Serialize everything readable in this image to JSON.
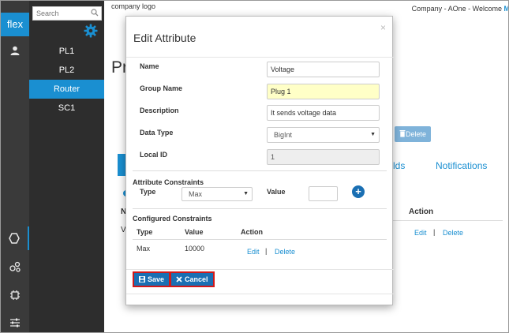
{
  "rail": {
    "logo": "flex",
    "icons": [
      "user-icon",
      "hexagon-icon",
      "network-icon",
      "chip-icon",
      "sliders-icon"
    ]
  },
  "sidebar": {
    "search_placeholder": "Search",
    "items": [
      {
        "label": "PL1",
        "active": false
      },
      {
        "label": "PL2",
        "active": false
      },
      {
        "label": "Router",
        "active": true
      },
      {
        "label": "SC1",
        "active": false
      }
    ]
  },
  "header": {
    "company_logo": "company logo",
    "welcome_text": "Company - AOne - Welcome",
    "user_initial": "M"
  },
  "background": {
    "page_title": "Pr",
    "delete_label": "Delete",
    "tab_fields": "lds",
    "tab_notifications": "Notifications",
    "col_n": "N",
    "col_v": "V",
    "action_header": "Action",
    "edit_label": "Edit",
    "sep": "|",
    "delete_link": "Delete"
  },
  "modal": {
    "title": "Edit Attribute",
    "close": "×",
    "fields": {
      "name_label": "Name",
      "name_value": "Voltage",
      "group_label": "Group Name",
      "group_value": "Plug 1",
      "desc_label": "Description",
      "desc_value": "It sends voltage data",
      "type_label": "Data Type",
      "type_value": "BigInt",
      "id_label": "Local ID",
      "id_value": "1"
    },
    "constraints": {
      "title": "Attribute Constraints",
      "type_label": "Type",
      "type_value": "Max",
      "value_label": "Value",
      "value_input": "",
      "add": "+"
    },
    "configured": {
      "title": "Configured Constraints",
      "headers": [
        "Type",
        "Value",
        "Action"
      ],
      "rows": [
        {
          "type": "Max",
          "value": "10000",
          "edit": "Edit",
          "sep": "|",
          "delete": "Delete"
        }
      ]
    },
    "buttons": {
      "save": "Save",
      "cancel": "Cancel"
    }
  },
  "colors": {
    "accent": "#1a8fd1",
    "button": "#1a6fb3",
    "highlight_border": "#d21919",
    "rail": "#3a3a3a",
    "sidebar": "#2d2d2d"
  }
}
